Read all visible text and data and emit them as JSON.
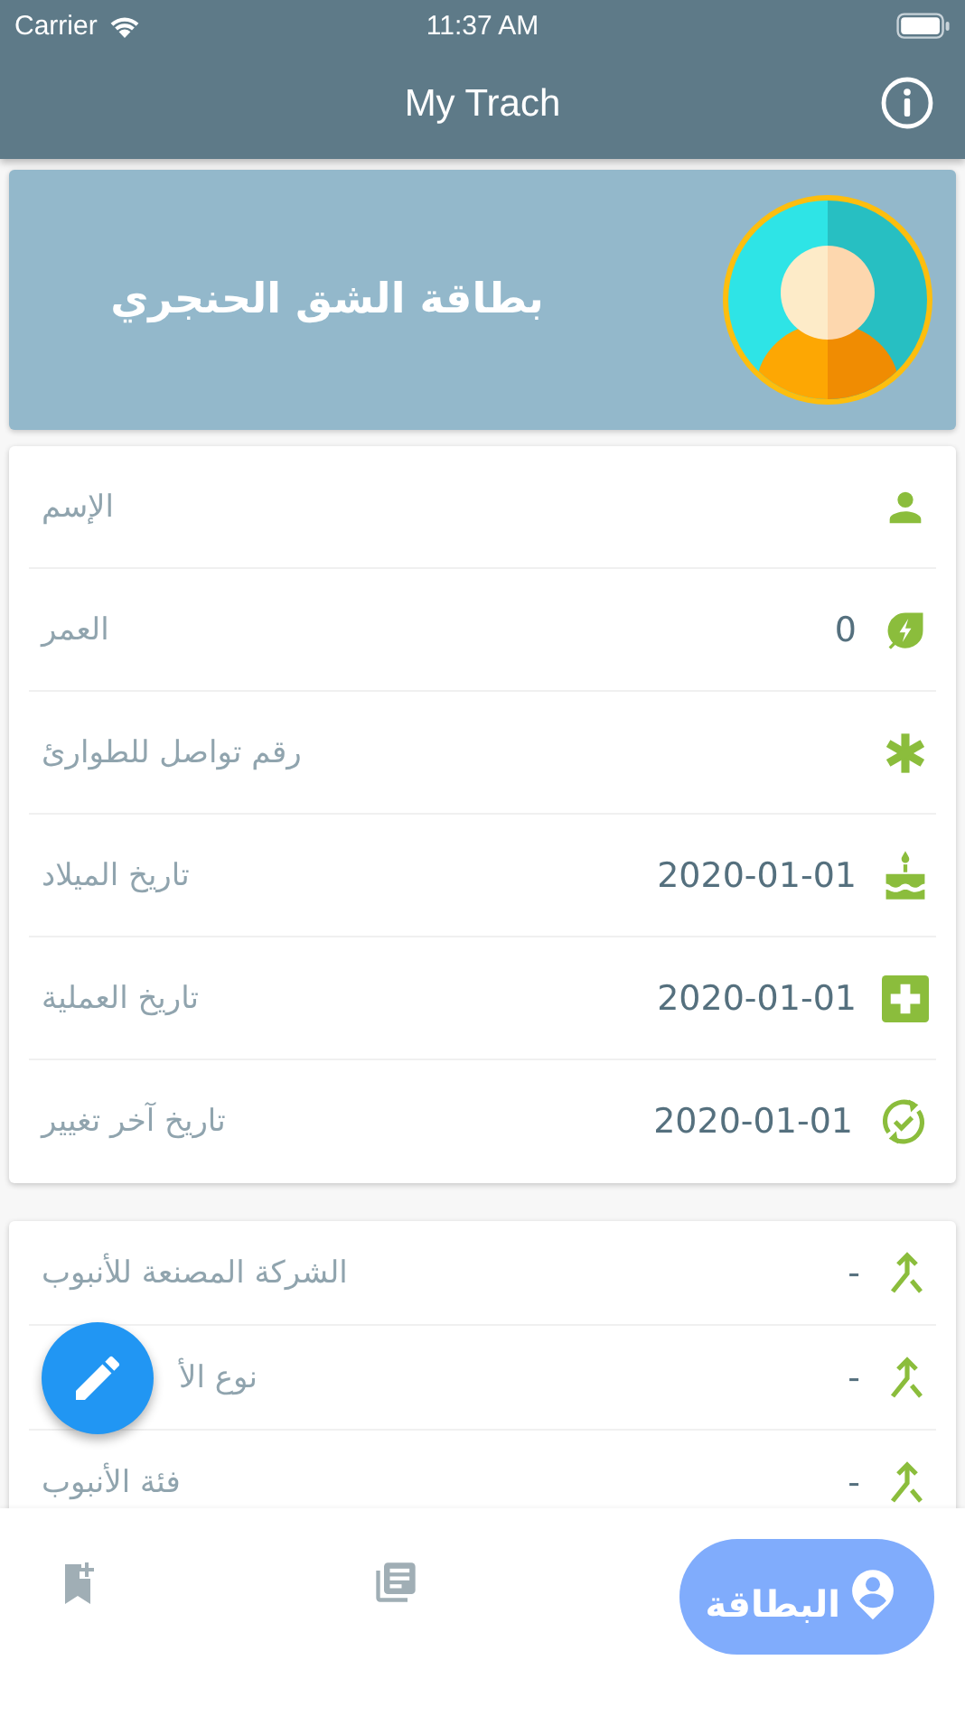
{
  "status_bar": {
    "carrier": "Carrier",
    "time": "11:37 AM"
  },
  "nav_bar": {
    "title": "My Trach"
  },
  "header_card": {
    "title": "بطاقة الشق الحنجري"
  },
  "sections": [
    {
      "rows": [
        {
          "label": "الإسم"
        },
        {
          "label": "العمر",
          "value": "0"
        },
        {
          "label": "رقم تواصل للطوارئ"
        },
        {
          "label": "تاريخ الميلاد",
          "value": "2020-01-01"
        },
        {
          "label": "تاريخ العملية",
          "value": "2020-01-01"
        },
        {
          "label": "تاريخ آخر تغيير",
          "value": "2020-01-01"
        }
      ]
    },
    {
      "rows": [
        {
          "label": "الشركة المصنعة للأنبوب",
          "value": "-"
        },
        {
          "label": "نوع الأ",
          "value": "-"
        },
        {
          "label": "فئة الأنبوب",
          "value": "-"
        }
      ]
    }
  ],
  "tabs": [
    {
      "selected": false
    },
    {
      "selected": false
    },
    {
      "label": "البطاقة",
      "selected": true
    }
  ]
}
